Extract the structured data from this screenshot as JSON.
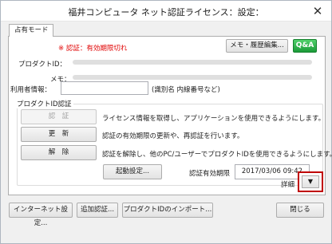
{
  "window": {
    "title": "福井コンピュータ ネット認証ライセンス：設定：",
    "close_glyph": "✕"
  },
  "tab": {
    "label": "占有モード"
  },
  "status": {
    "error_text": "※ 認証：有効期限切れ",
    "error_color": "#e00000"
  },
  "top_buttons": {
    "memo_history": "メモ・履歴編集...",
    "qa": "Q&A"
  },
  "fields": {
    "product_id_label": "プロダクトID：",
    "memo_label": "メモ：",
    "user_info_label": "利用者情報：",
    "user_info_hint": "(識別名 内線番号など)"
  },
  "auth_group": {
    "title": "プロダクトID認証",
    "auth_button": "認　証",
    "auth_desc": "ライセンス情報を取得し、アプリケーションを使用できるようにします。",
    "update_button": "更　新",
    "update_desc": "認証の有効期限の更新や、再認証を行います。",
    "release_button": "解　除",
    "release_desc": "認証を解除し、他のPC/ユーザーでプロダクトIDを使用できるようにします。",
    "startup_button": "起動設定...",
    "expiry_label": "認証有効期限",
    "expiry_value": "2017/03/06 09:42"
  },
  "detail": {
    "label": "詳細",
    "arrow": "▼"
  },
  "bottom_buttons": {
    "internet": "インターネット設定...",
    "additional_auth": "追加認証...",
    "import_pid": "プロダクトIDのインポート...",
    "close": "閉じる"
  }
}
